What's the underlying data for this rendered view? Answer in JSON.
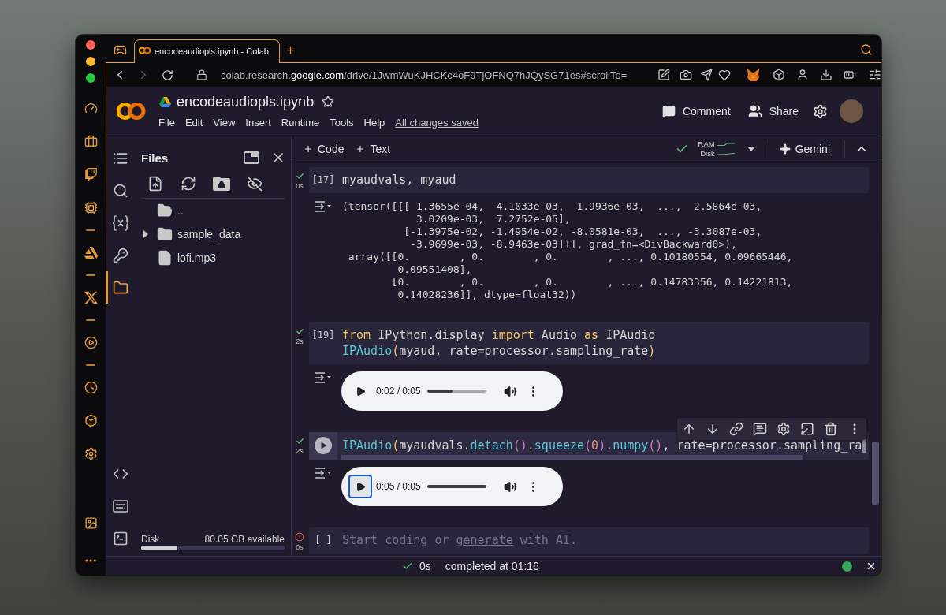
{
  "browser": {
    "tab": {
      "title": "encodeaudiopls.ipynb - Colab",
      "selected": true
    },
    "address": {
      "before": "colab.research.",
      "domain": "google.com",
      "after": "/drive/1JwmWuKJHCKc4oF9TjOFNQ7hJQySG71es#scrollTo="
    }
  },
  "header": {
    "title": "encodeaudiopls.ipynb",
    "starred": false,
    "menu": [
      "File",
      "Edit",
      "View",
      "Insert",
      "Runtime",
      "Tools",
      "Help"
    ],
    "save_status": "All changes saved",
    "actions": [
      {
        "kind": "comment",
        "label": "Comment"
      },
      {
        "kind": "share",
        "label": "Share"
      }
    ]
  },
  "toolbar": {
    "add": [
      "Code",
      "Text"
    ],
    "runtime_ok": true,
    "ram_label": "RAM",
    "disk_label": "Disk",
    "assistant": "Gemini"
  },
  "side_rail": [
    {
      "kind": "toc",
      "selected": false
    },
    {
      "kind": "search",
      "selected": false
    },
    {
      "kind": "variables",
      "selected": false
    },
    {
      "kind": "secrets",
      "selected": false
    },
    {
      "kind": "files",
      "selected": true
    }
  ],
  "files": {
    "title": "Files",
    "tree": [
      {
        "kind": "parent",
        "name": ".."
      },
      {
        "kind": "folder",
        "name": "sample_data",
        "expanded": false
      },
      {
        "kind": "file",
        "name": "lofi.mp3"
      }
    ],
    "disk": {
      "label": "Disk",
      "available": "80.05 GB available",
      "level": 0.25
    }
  },
  "cells": [
    {
      "kind": "code",
      "error": false,
      "duration": "0s",
      "count": "[17]",
      "focused": false,
      "code": [
        [
          {
            "kind": "plain",
            "text": "myaudvals, myaud"
          }
        ]
      ],
      "output": {
        "kind": "text",
        "lines": [
          "(tensor([[[ 1.3655e-04, -4.1033e-03,  1.9936e-03,  ...,  2.5864e-03,",
          "            3.0209e-03,  7.2752e-05],",
          "          [-1.3975e-02, -1.4954e-02, -8.0581e-03,  ..., -3.3087e-03,",
          "           -3.9699e-03, -8.9463e-03]]], grad_fn=<DivBackward0>),",
          " array([[0.        , 0.        , 0.        , ..., 0.10180554, 0.09665446,",
          "         0.09551408],",
          "        [0.        , 0.        , 0.        , ..., 0.14783356, 0.14221813,",
          "         0.14028236]], dtype=float32))"
        ]
      }
    },
    {
      "kind": "code",
      "error": false,
      "duration": "2s",
      "count": "[19]",
      "focused": false,
      "code": [
        [
          {
            "kind": "keyword",
            "text": "from"
          },
          {
            "kind": "plain",
            "text": " IPython.display "
          },
          {
            "kind": "keyword",
            "text": "import"
          },
          {
            "kind": "plain",
            "text": " Audio "
          },
          {
            "kind": "keyword",
            "text": "as"
          },
          {
            "kind": "plain",
            "text": " IPAudio"
          }
        ],
        [
          {
            "kind": "function",
            "text": "IPAudio"
          },
          {
            "kind": "bracket1",
            "text": "("
          },
          {
            "kind": "plain",
            "text": "myaud, rate=processor.sampling_rate"
          },
          {
            "kind": "bracket1",
            "text": ")"
          }
        ]
      ],
      "output": {
        "kind": "audio",
        "time": "0:02 / 0:05",
        "level": 0.43,
        "focused": false
      }
    },
    {
      "kind": "code",
      "error": false,
      "duration": "2s",
      "focused": true,
      "code": [
        [
          {
            "kind": "function",
            "text": "IPAudio"
          },
          {
            "kind": "bracket1",
            "text": "("
          },
          {
            "kind": "plain",
            "text": "myaudvals."
          },
          {
            "kind": "function",
            "text": "detach"
          },
          {
            "kind": "bracket2",
            "text": "()"
          },
          {
            "kind": "plain",
            "text": "."
          },
          {
            "kind": "function",
            "text": "squeeze"
          },
          {
            "kind": "bracket2",
            "text": "("
          },
          {
            "kind": "number",
            "text": "0"
          },
          {
            "kind": "bracket2",
            "text": ")"
          },
          {
            "kind": "plain",
            "text": "."
          },
          {
            "kind": "function",
            "text": "numpy"
          },
          {
            "kind": "bracket2",
            "text": "()"
          },
          {
            "kind": "plain",
            "text": ", rate=processor.sampling_ra"
          }
        ]
      ],
      "output": {
        "kind": "audio",
        "time": "0:05 / 0:05",
        "level": 1,
        "focused": true
      }
    },
    {
      "kind": "empty",
      "error": true,
      "duration": "0s",
      "count": "[ ]",
      "focused": false,
      "placeholder": {
        "before": "Start coding or ",
        "link": "generate",
        "after": " with AI."
      }
    }
  ],
  "status_bar": {
    "duration": "0s",
    "message": "completed at 01:16",
    "connected": true
  }
}
